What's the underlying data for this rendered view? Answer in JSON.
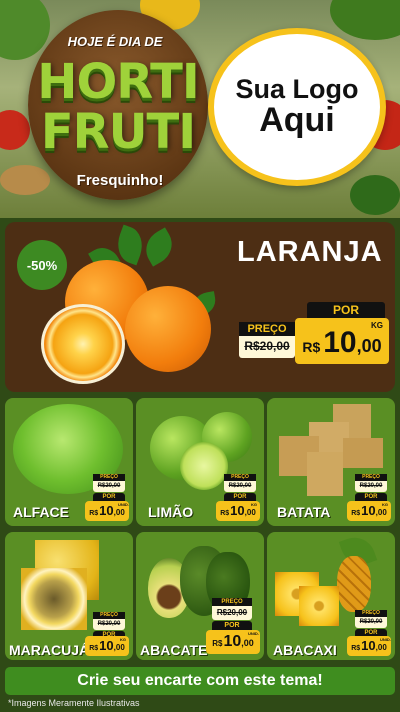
{
  "header": {
    "tagline": "HOJE É DIA DE",
    "brand_line1": "HORTI",
    "brand_line2": "FRUTI",
    "subtag": "Fresquinho!",
    "logo_line1": "Sua Logo",
    "logo_line2": "Aqui"
  },
  "featured": {
    "discount": "-50%",
    "name": "LARANJA",
    "por_label": "POR",
    "preco_label": "PREÇO",
    "old_price": "R$20,00",
    "currency": "R$",
    "price_int": "10",
    "price_dec": ",00",
    "unit": "KG"
  },
  "products": [
    {
      "name": "ALFACE",
      "preco_label": "PREÇO",
      "old_price": "R$20,00",
      "por_label": "POR",
      "currency": "R$",
      "price_int": "10",
      "price_dec": ",00",
      "unit": "UNID."
    },
    {
      "name": "LIMÃO",
      "preco_label": "PREÇO",
      "old_price": "R$20,00",
      "por_label": "POR",
      "currency": "R$",
      "price_int": "10",
      "price_dec": ",00",
      "unit": "KG"
    },
    {
      "name": "BATATA",
      "preco_label": "PREÇO",
      "old_price": "R$20,00",
      "por_label": "POR",
      "currency": "R$",
      "price_int": "10",
      "price_dec": ",00",
      "unit": "KG"
    },
    {
      "name": "MARACUJÁ",
      "preco_label": "PREÇO",
      "old_price": "R$20,00",
      "por_label": "POR",
      "currency": "R$",
      "price_int": "10",
      "price_dec": ",00",
      "unit": "KG"
    },
    {
      "name": "ABACATE",
      "preco_label": "PREÇO",
      "old_price": "R$20,00",
      "por_label": "POR",
      "currency": "R$",
      "price_int": "10",
      "price_dec": ",00",
      "unit": "UNID."
    },
    {
      "name": "ABACAXI",
      "preco_label": "PREÇO",
      "old_price": "R$20,00",
      "por_label": "POR",
      "currency": "R$",
      "price_int": "10",
      "price_dec": ",00",
      "unit": "UNID."
    }
  ],
  "cta": "Crie seu encarte com este tema!",
  "disclaimer": "*Imagens Meramente Ilustrativas",
  "colors": {
    "accent_yellow": "#f6c21b",
    "card_green": "#5a8f24",
    "featured_brown": "#4d2e14",
    "cta_green": "#3f8d1f"
  }
}
